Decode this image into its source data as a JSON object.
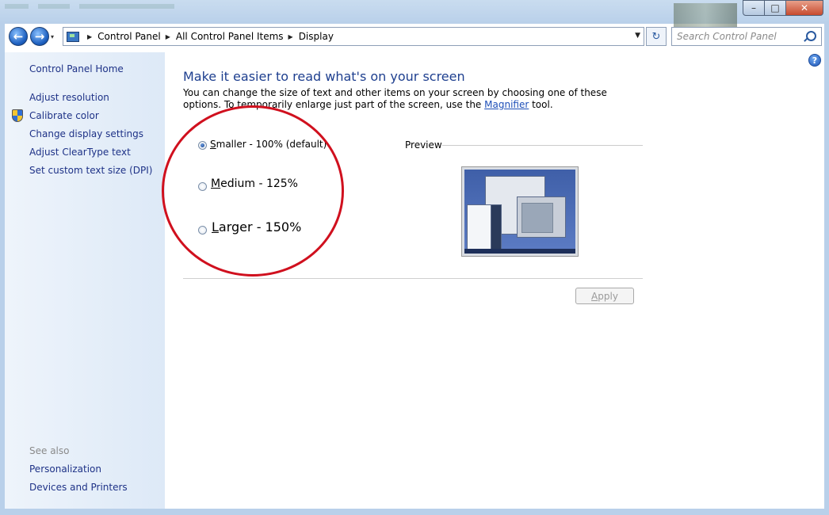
{
  "window": {
    "min_glyph": "–",
    "max_glyph": "□",
    "close_glyph": "✕"
  },
  "nav": {
    "back_glyph": "←",
    "forward_glyph": "→",
    "dropdown_glyph": "▾"
  },
  "address": {
    "breadcrumbs": [
      "Control Panel",
      "All Control Panel Items",
      "Display"
    ],
    "separator_glyph": "▶",
    "dropdown_glyph": "▼",
    "refresh_glyph": "↻"
  },
  "search": {
    "placeholder": "Search Control Panel"
  },
  "sidebar": {
    "home": "Control Panel Home",
    "items": [
      {
        "label": "Adjust resolution"
      },
      {
        "label": "Calibrate color",
        "icon": "shield-icon"
      },
      {
        "label": "Change display settings"
      },
      {
        "label": "Adjust ClearType text"
      },
      {
        "label": "Set custom text size (DPI)"
      }
    ],
    "see_also": "See also",
    "see_also_items": [
      "Personalization",
      "Devices and Printers"
    ]
  },
  "main": {
    "help_glyph": "?",
    "title": "Make it easier to read what's on your screen",
    "desc_before": "You can change the size of text and other items on your screen by choosing one of these options. To temporarily enlarge just part of the screen, use the ",
    "desc_link": "Magnifier",
    "desc_after": " tool.",
    "options": [
      {
        "hotkey": "S",
        "rest": "maller - 100% (default)",
        "selected": true
      },
      {
        "hotkey": "M",
        "rest": "edium - 125%",
        "selected": false
      },
      {
        "hotkey": "L",
        "rest": "arger - 150%",
        "selected": false
      }
    ],
    "preview_label": "Preview",
    "apply_hotkey": "A",
    "apply_rest": "pply"
  },
  "colors": {
    "link": "#1e3287",
    "title": "#1e3f8f",
    "annotation": "#d0101e"
  }
}
